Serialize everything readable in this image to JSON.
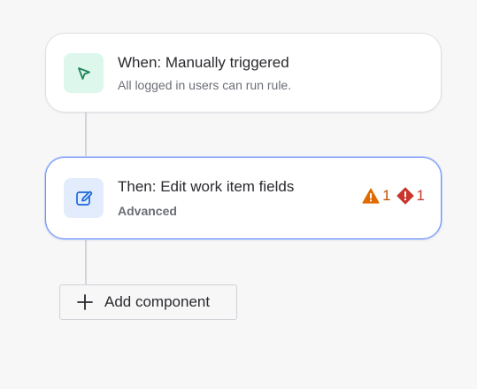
{
  "trigger": {
    "title": "When: Manually triggered",
    "subtitle": "All logged in users can run rule.",
    "icon": "cursor-arrow-icon"
  },
  "action": {
    "title": "Then: Edit work item fields",
    "subtitle": "Advanced",
    "icon": "edit-pencil-icon",
    "warning_count": "1",
    "error_count": "1"
  },
  "add_component": {
    "label": "Add component",
    "icon": "plus-icon"
  },
  "colors": {
    "trigger_tile": "#ddf7ec",
    "trigger_icon": "#1f845a",
    "action_tile": "#e2ecfc",
    "action_icon": "#1868db",
    "selected_border": "#6b8ff5",
    "warning": "#e06c00",
    "error": "#c9372c"
  }
}
